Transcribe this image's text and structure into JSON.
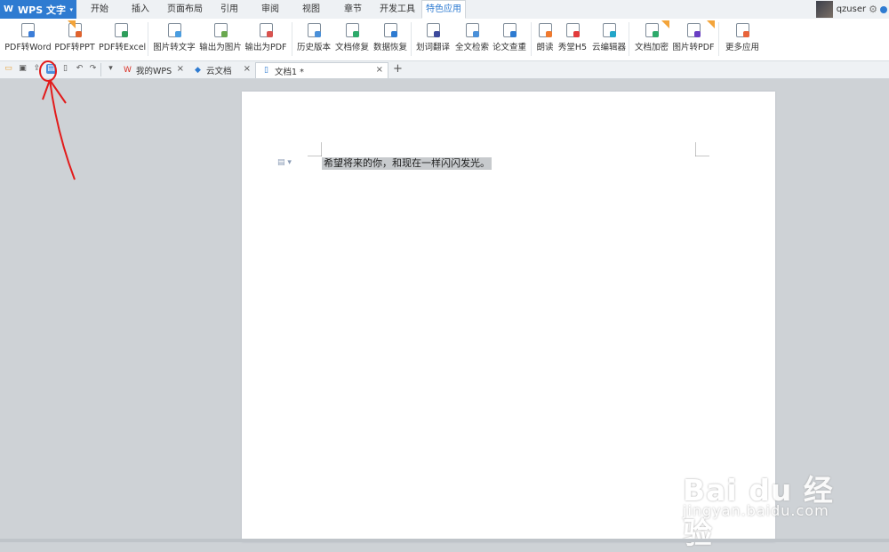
{
  "app": {
    "name": "WPS 文字",
    "logo_glyph": "W",
    "caret": "▾"
  },
  "menu": {
    "tabs": [
      "开始",
      "插入",
      "页面布局",
      "引用",
      "审阅",
      "视图",
      "章节",
      "开发工具",
      "特色应用"
    ],
    "active_index": 8
  },
  "user": {
    "name": "qzuser",
    "gear_glyph": "⚙"
  },
  "ribbon": {
    "items": [
      {
        "label": "PDF转Word",
        "color": "#3b7dd8"
      },
      {
        "label": "PDF转PPT",
        "color": "#e0632e"
      },
      {
        "label": "PDF转Excel",
        "color": "#2e9e5b"
      },
      {
        "label": "图片转文字",
        "color": "#4a9de0"
      },
      {
        "label": "输出为图片",
        "color": "#6aa84f"
      },
      {
        "label": "输出为PDF",
        "color": "#d9534f"
      },
      {
        "label": "历史版本",
        "color": "#4a90d9"
      },
      {
        "label": "文档修复",
        "color": "#2eaa6b"
      },
      {
        "label": "数据恢复",
        "color": "#2e7bd1"
      },
      {
        "label": "划词翻译",
        "color": "#3c4a9c"
      },
      {
        "label": "全文检索",
        "color": "#4a90d9"
      },
      {
        "label": "论文查重",
        "color": "#2e7bd1"
      },
      {
        "label": "朗读",
        "color": "#f07a2e"
      },
      {
        "label": "秀堂H5",
        "color": "#e23b3b"
      },
      {
        "label": "云编辑器",
        "color": "#22a6c9"
      },
      {
        "label": "文档加密",
        "color": "#2eaa6b"
      },
      {
        "label": "图片转PDF",
        "color": "#6a3fc4"
      },
      {
        "label": "更多应用",
        "color": "#e8643b"
      }
    ]
  },
  "quick_toolbar": {
    "icons": [
      "open-folder-icon",
      "save-icon",
      "export-icon",
      "print-icon",
      "print-preview-icon",
      "undo-icon",
      "redo-icon",
      "customize-dropdown-icon"
    ],
    "glyphs": [
      "▭",
      "▣",
      "⇪",
      "▤",
      "▯",
      "↶",
      "↷",
      "▾"
    ]
  },
  "doc_tabs": [
    {
      "label": "我的WPS",
      "icon_glyph": "W",
      "color": "#d93025",
      "close": "×"
    },
    {
      "label": "云文档",
      "icon_glyph": "◆",
      "color": "#2e7bd1",
      "close": "×"
    },
    {
      "label": "文档1 *",
      "icon_glyph": "▯",
      "color": "#2e7bd1",
      "close": "×"
    }
  ],
  "new_tab_glyph": "+",
  "document": {
    "text": "希望将来的你，和现在一样闪闪发光。",
    "para_glyph": "▤ ▾"
  },
  "watermark": {
    "logo": "Bai du 经验",
    "url": "jingyan.baidu.com"
  }
}
